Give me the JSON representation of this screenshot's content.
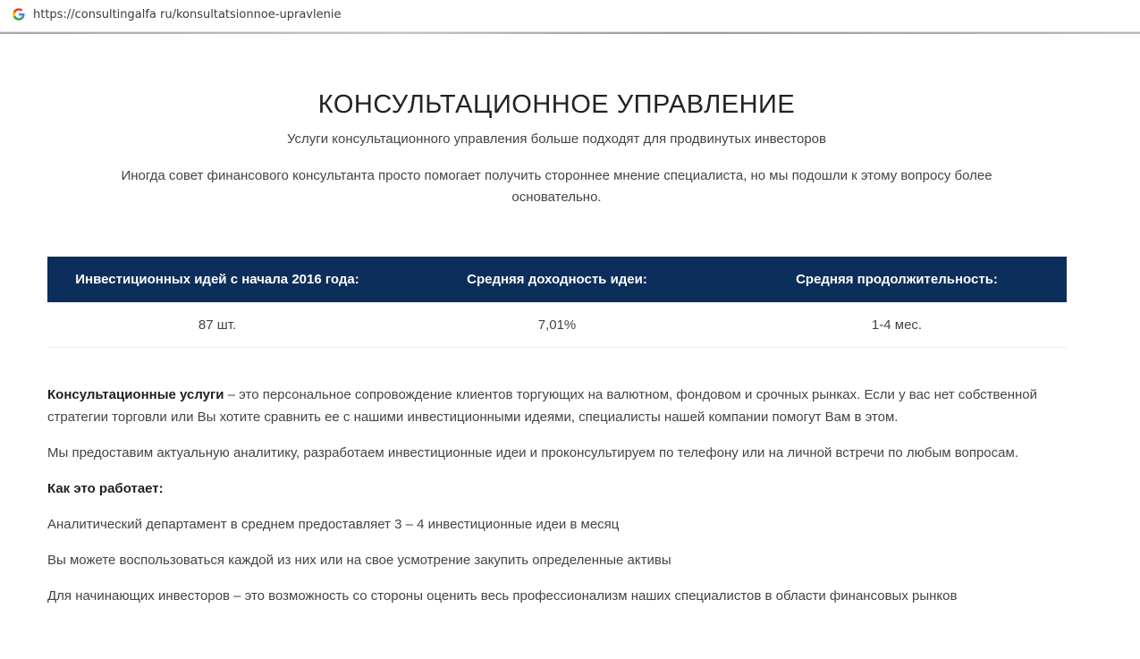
{
  "browser": {
    "url": "https://consultingalfa ru/konsultatsionnoe-upravlenie",
    "favicon": "google-g-icon"
  },
  "page": {
    "title": "КОНСУЛЬТАЦИОННОЕ УПРАВЛЕНИЕ",
    "subtitle": "Услуги консультационного управления больше подходят для продвинутых инвесторов",
    "intro": "Иногда совет финансового консультанта просто помогает получить стороннее мнение специалиста, но мы подошли к этому вопросу более основательно."
  },
  "stats": {
    "headers": [
      "Инвестиционных идей с начала 2016 года:",
      "Средняя доходность идеи:",
      "Средняя продолжительность:"
    ],
    "values": [
      "87 шт.",
      "7,01%",
      "1-4 мес."
    ],
    "header_color": "#0c2e5a"
  },
  "content": {
    "p1_bold": "Консультационные услуги",
    "p1_rest": " – это персональное сопровождение клиентов торгующих на валютном, фондовом и срочных рынках. Если у вас нет собственной стратегии торговли или Вы хотите сравнить ее с нашими инвестиционными идеями, специалисты нашей компании помогут Вам в этом.",
    "p2": "Мы предоставим актуальную аналитику, разработаем инвестиционные идеи и проконсультируем по телефону или на личной встречи по любым вопросам.",
    "how_heading": "Как это работает:",
    "p3": "Аналитический департамент в среднем предоставляет 3 – 4 инвестиционные идеи в месяц",
    "p4": "Вы можете воспользоваться каждой из них или на свое усмотрение закупить определенные активы",
    "p5": "Для начинающих инвесторов – это возможность со стороны оценить весь профессионализм наших специалистов в области финансовых рынков"
  }
}
